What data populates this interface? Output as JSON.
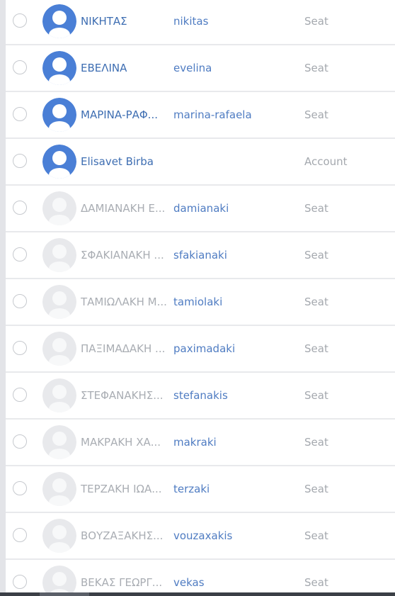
{
  "colors": {
    "active_avatar_bg": "#4a7fd6",
    "active_avatar_fg": "#ffffff",
    "inactive_avatar_bg": "#e8e9ec",
    "inactive_avatar_fg": "#f7f8f9",
    "name_active": "#3e6eb2",
    "name_inactive": "#a9adb3",
    "username": "#4f7cc2",
    "type": "#a4a8ae"
  },
  "users": [
    {
      "name": "ΝΙΚΗΤΑΣ",
      "username": "nikitas",
      "type": "Seat",
      "active": true
    },
    {
      "name": "ΕΒΕΛΙΝΑ",
      "username": "evelina",
      "type": "Seat",
      "active": true
    },
    {
      "name": "ΜΑΡΙΝΑ-ΡΑΦ...",
      "username": "marina-rafaela",
      "type": "Seat",
      "active": true
    },
    {
      "name": "Elisavet Birba",
      "username": "",
      "type": "Account",
      "active": true
    },
    {
      "name": "ΔΑΜΙΑΝΑΚΗ Ε...",
      "username": "damianaki",
      "type": "Seat",
      "active": false
    },
    {
      "name": "ΣΦΑΚΙΑΝΑΚΗ ...",
      "username": "sfakianaki",
      "type": "Seat",
      "active": false
    },
    {
      "name": "ΤΑΜΙΩΛΑΚΗ Μ...",
      "username": "tamiolaki",
      "type": "Seat",
      "active": false
    },
    {
      "name": "ΠΑΞΙΜΑΔΑΚΗ ...",
      "username": "paximadaki",
      "type": "Seat",
      "active": false
    },
    {
      "name": "ΣΤΕΦΑΝΑΚΗΣ...",
      "username": "stefanakis",
      "type": "Seat",
      "active": false
    },
    {
      "name": "ΜΑΚΡΑΚΗ ΧΑ...",
      "username": "makraki",
      "type": "Seat",
      "active": false
    },
    {
      "name": "ΤΕΡΖΑΚΗ ΙΩΑ...",
      "username": "terzaki",
      "type": "Seat",
      "active": false
    },
    {
      "name": "ΒΟΥΖΑΞΑΚΗΣ...",
      "username": "vouzaxakis",
      "type": "Seat",
      "active": false
    },
    {
      "name": "ΒΕΚΑΣ ΓΕΩΡΓ...",
      "username": "vekas",
      "type": "Seat",
      "active": false
    }
  ]
}
